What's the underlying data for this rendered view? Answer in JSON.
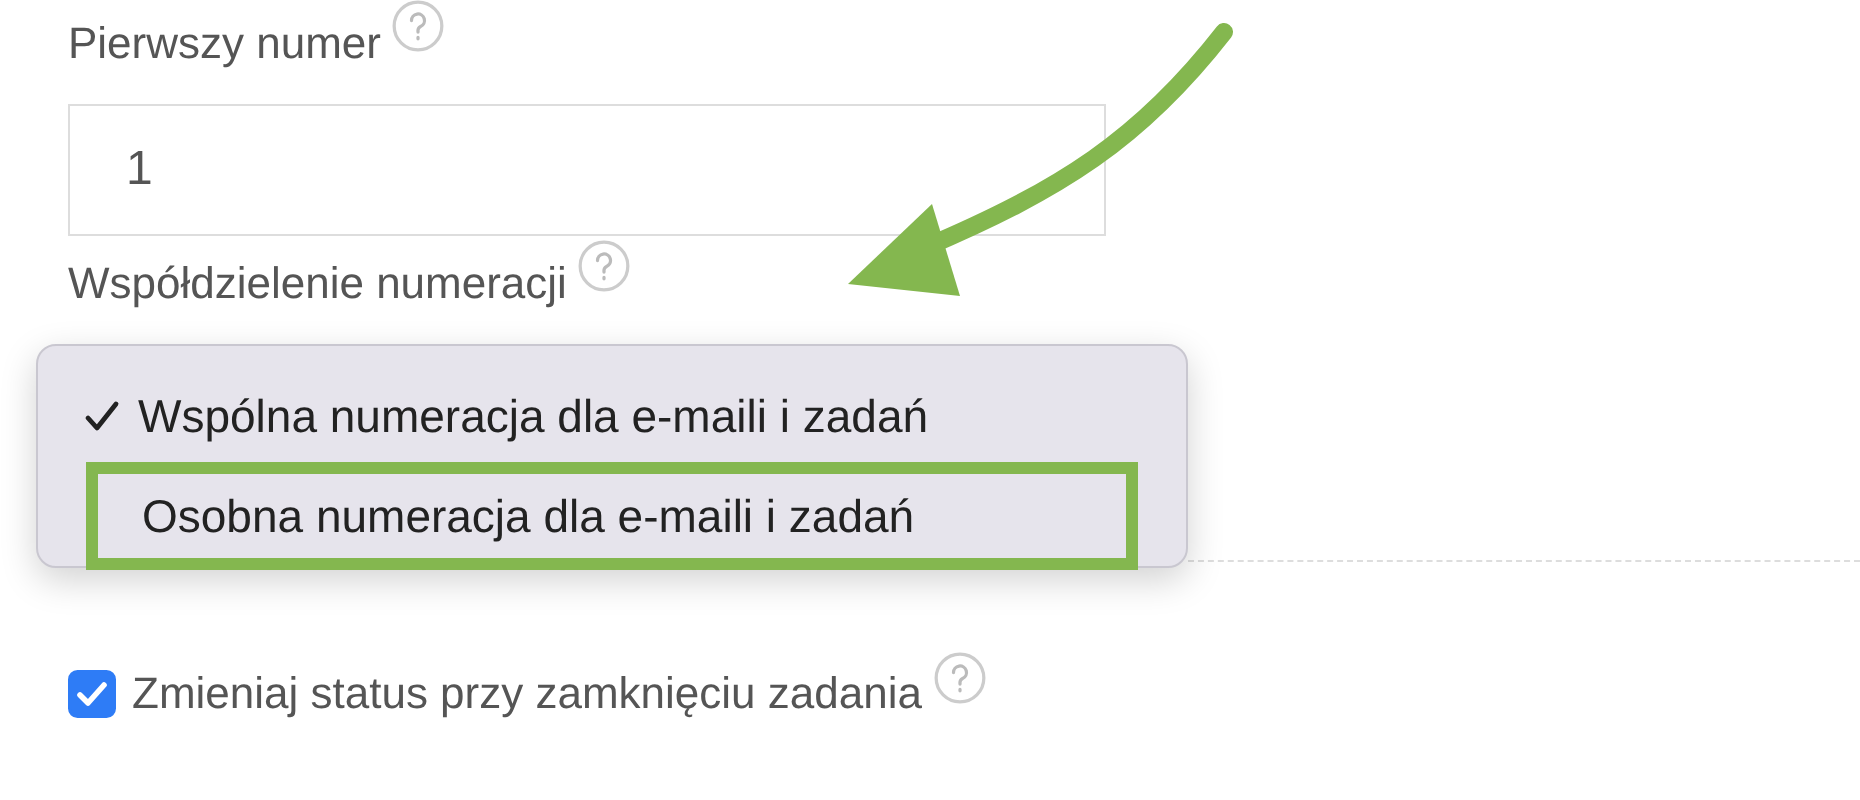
{
  "first_number": {
    "label": "Pierwszy numer",
    "value": "1"
  },
  "numbering_sharing": {
    "label": "Współdzielenie numeracji",
    "options": [
      {
        "label": "Wspólna numeracja dla e-maili i zadań",
        "selected": true,
        "highlighted": false
      },
      {
        "label": "Osobna numeracja dla e-maili i zadań",
        "selected": false,
        "highlighted": true
      }
    ]
  },
  "change_status": {
    "label": "Zmieniaj status przy zamknięciu zadania",
    "checked": true
  }
}
